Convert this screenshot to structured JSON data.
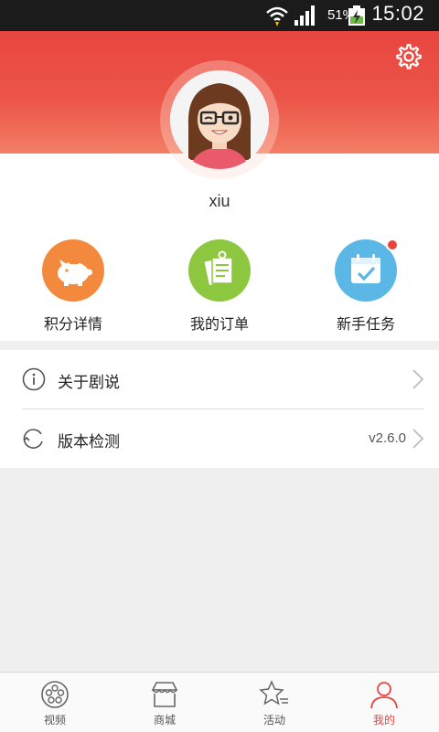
{
  "status_bar": {
    "battery_percent": "51%",
    "time": "15:02"
  },
  "profile": {
    "username": "xiu"
  },
  "shortcuts": [
    {
      "label": "积分详情",
      "color": "#f3893d",
      "icon": "piggy-bank-icon"
    },
    {
      "label": "我的订单",
      "color": "#8dc63f",
      "icon": "order-list-icon"
    },
    {
      "label": "新手任务",
      "color": "#5bb7e5",
      "icon": "calendar-check-icon",
      "has_badge": true
    }
  ],
  "menu": [
    {
      "label": "关于剧说",
      "icon": "info-icon",
      "value": ""
    },
    {
      "label": "版本检测",
      "icon": "refresh-icon",
      "value": "v2.6.0"
    }
  ],
  "bottom_nav": [
    {
      "label": "视频",
      "icon": "film-reel-icon",
      "active": false
    },
    {
      "label": "商城",
      "icon": "shop-icon",
      "active": false
    },
    {
      "label": "活动",
      "icon": "star-icon",
      "active": false
    },
    {
      "label": "我的",
      "icon": "person-icon",
      "active": true
    }
  ],
  "colors": {
    "accent": "#e8453f",
    "header_top": "#e8453f",
    "header_bottom": "#f37e64"
  }
}
